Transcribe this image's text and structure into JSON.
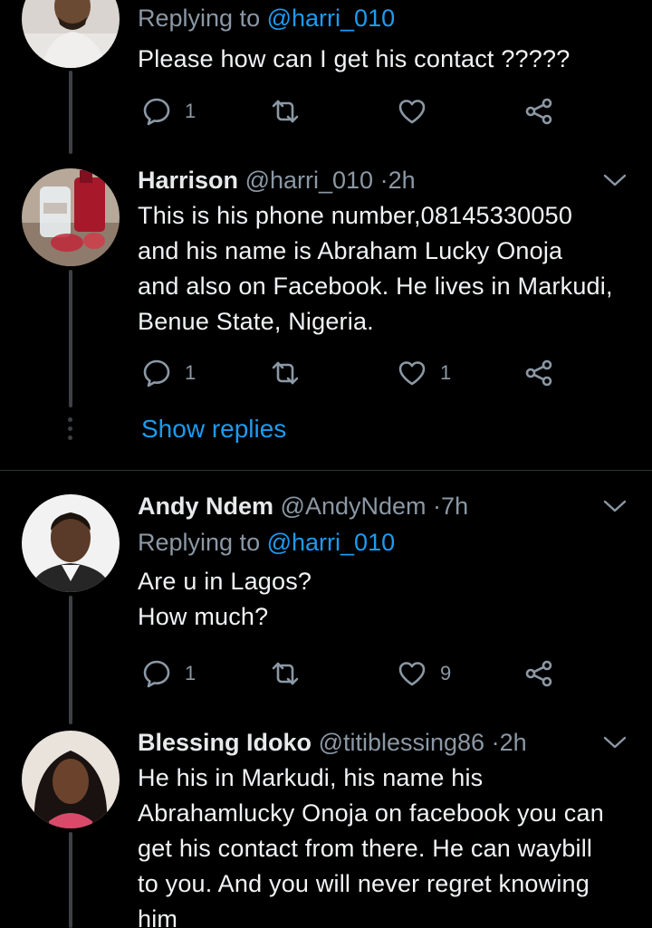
{
  "tweets": [
    {
      "replying_prefix": "Replying to",
      "replying_to": "@harri_010",
      "lines": [
        "Please how can I get his contact ?????"
      ],
      "replies": "1",
      "retweets": "",
      "likes": ""
    },
    {
      "name": "Harrison",
      "handle": "@harri_010",
      "dot": "·",
      "time": "2h",
      "lines": [
        "This is his phone number,08145330050",
        "and his name is Abraham Lucky Onoja",
        "and also on Facebook. He lives in Markudi,",
        "Benue State, Nigeria."
      ],
      "replies": "1",
      "retweets": "",
      "likes": "1"
    },
    {
      "name": "Andy Ndem",
      "handle": "@AndyNdem",
      "dot": "·",
      "time": "7h",
      "replying_prefix": "Replying to",
      "replying_to": "@harri_010",
      "lines": [
        "Are u in Lagos?",
        "How much?"
      ],
      "replies": "1",
      "retweets": "",
      "likes": "9"
    },
    {
      "name": "Blessing Idoko",
      "handle": "@titiblessing86",
      "dot": "·",
      "time": "2h",
      "lines": [
        "He his in Markudi, his name his",
        "Abrahamlucky Onoja on facebook you can",
        "get his contact from there. He can waybill",
        "to you. And you will never regret knowing",
        "him"
      ]
    }
  ],
  "show_replies": "Show replies",
  "colors": {
    "background": "#000000",
    "accent": "#1d9bf0",
    "secondary_text": "#8b98a5",
    "thread_line": "#3d4145"
  },
  "icons": [
    "reply-icon",
    "retweet-icon",
    "like-icon",
    "share-icon",
    "chevron-down-icon"
  ]
}
